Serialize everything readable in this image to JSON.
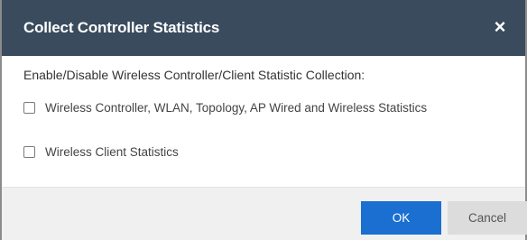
{
  "dialog": {
    "title": "Collect Controller Statistics",
    "close_label": "×"
  },
  "content": {
    "prompt": "Enable/Disable Wireless Controller/Client Statistic Collection:",
    "options": [
      {
        "label": "Wireless Controller, WLAN, Topology, AP Wired and Wireless Statistics",
        "checked": false
      },
      {
        "label": "Wireless Client Statistics",
        "checked": false
      }
    ]
  },
  "footer": {
    "ok_label": "OK",
    "cancel_label": "Cancel"
  },
  "colors": {
    "titlebar": "#3a4b5e",
    "ok_button": "#1a6fd1",
    "cancel_button": "#dcdcdc"
  }
}
